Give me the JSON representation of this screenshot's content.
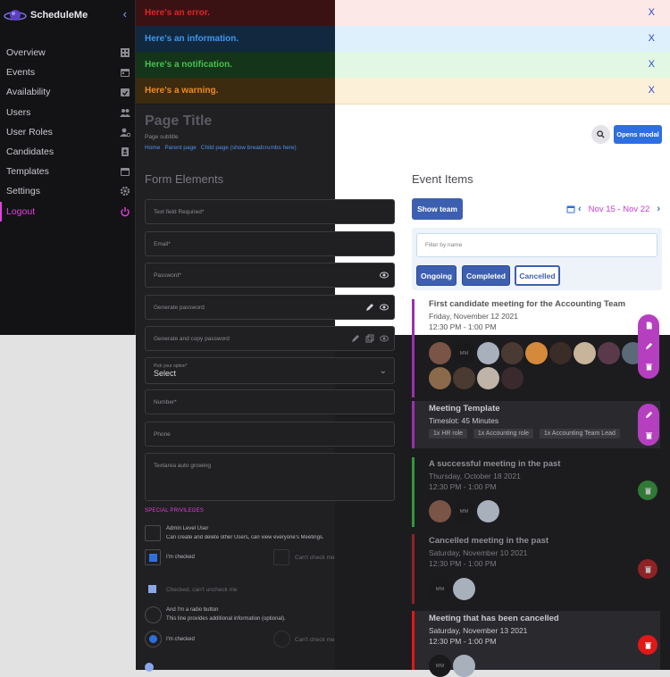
{
  "app": {
    "name": "ScheduleMe"
  },
  "sidebar": {
    "items": [
      {
        "label": "Overview",
        "icon": "building-icon"
      },
      {
        "label": "Events",
        "icon": "calendar-icon"
      },
      {
        "label": "Availability",
        "icon": "calendar-check-icon"
      },
      {
        "label": "Users",
        "icon": "users-icon"
      },
      {
        "label": "User Roles",
        "icon": "user-cog-icon"
      },
      {
        "label": "Candidates",
        "icon": "id-card-icon"
      },
      {
        "label": "Templates",
        "icon": "calendar-icon"
      },
      {
        "label": "Settings",
        "icon": "gear-icon"
      },
      {
        "label": "Logout",
        "icon": "power-icon"
      }
    ]
  },
  "toasts": [
    {
      "message": "Here's an error.",
      "type": "error",
      "close": "X"
    },
    {
      "message": "Here's an information.",
      "type": "info",
      "close": "X"
    },
    {
      "message": "Here's a notification.",
      "type": "notification",
      "close": "X"
    },
    {
      "message": "Here's a warning.",
      "type": "warning",
      "close": "X"
    }
  ],
  "header": {
    "title": "Page Title",
    "subtitle": "Page subtitle",
    "breadcrumbs": [
      "Home",
      "Parent page",
      "Child page (show breadcrumbs here)"
    ],
    "modal_button": "Opens modal"
  },
  "form": {
    "title": "Form Elements",
    "text_field": "Text field Required*",
    "email": "Email*",
    "password": "Password*",
    "generate_password": "Generate password",
    "generate_copy_password": "Generate and copy password",
    "select_label": "Pick your option*",
    "select_value": "Select",
    "number": "Number*",
    "phone": "Phone",
    "textarea": "Textarea auto growing",
    "privileges_title": "SPECIAL PRIVILEGES",
    "admin_label": "Admin Level User",
    "admin_desc": "Can create and delete other Users, can view everyone's Meetings.",
    "checked_label": "I'm checked",
    "cant_check": "Can't check me",
    "checked_cant_uncheck": "Checked, can't uncheck me",
    "radio_label": "And I'm a radio button",
    "radio_desc": "This line provides additional information (optional).",
    "radio_checked": "I'm checked",
    "radio_cant_check": "Can't check me"
  },
  "events": {
    "title": "Event Items",
    "show_team": "Show team",
    "date_range": "Nov 15 - Nov 22",
    "filter_placeholder": "Filter by name",
    "filters": [
      "Ongoing",
      "Completed",
      "Cancelled"
    ],
    "cards": [
      {
        "title": "First candidate meeting for the Accounting Team",
        "date": "Friday, November 12 2021",
        "time": "12:30 PM - 1:00 PM",
        "color": "#9b2fae"
      },
      {
        "title": "Meeting Template",
        "date": "Timeslot: 45 Minutes",
        "chips": [
          "1x HR role",
          "1x Accounting role",
          "1x Accounting Team Lead"
        ],
        "color": "#9b2fae"
      },
      {
        "title": "A successful meeting in the past",
        "date": "Thursday, October 18 2021",
        "time": "12:30 PM - 1:00 PM",
        "color": "#2e9a3c"
      },
      {
        "title": "Cancelled meeting in the past",
        "date": "Saturday, November 10 2021",
        "time": "12:30 PM - 1:00 PM",
        "color": "#c0282a"
      },
      {
        "title": "Meeting that has been cancelled",
        "date": "Saturday, November 13 2021",
        "time": "12:30 PM - 1:00 PM",
        "color": "#e01818"
      }
    ],
    "initials": "MM"
  }
}
